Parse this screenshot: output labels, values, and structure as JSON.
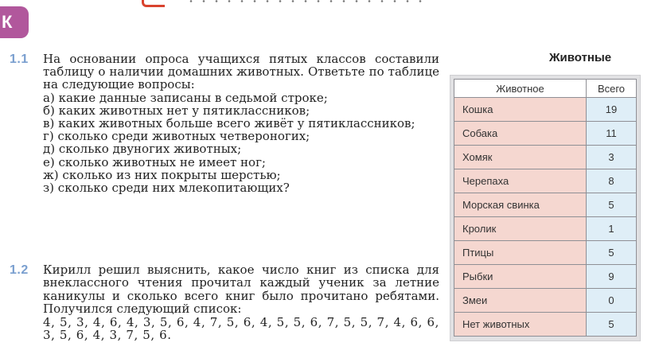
{
  "corner_tab": "К",
  "problem1": {
    "number": "1.1",
    "intro": "На основании опроса учащихся пятых классов составили таблицу о наличии домашних животных. Ответьте по таблице на следующие вопросы:",
    "questions": [
      "а) какие данные записаны в седьмой строке;",
      "б) каких животных нет у пятиклассников;",
      "в) каких животных больше всего живёт у пятиклассников;",
      "г) сколько среди животных четвероногих;",
      "д) сколько двуногих животных;",
      "е) сколько животных не имеет ног;",
      "ж) сколько из них покрыты шерстью;",
      "з) сколько среди них млекопитающих?"
    ]
  },
  "problem2": {
    "number": "1.2",
    "text": "Кирилл решил выяснить, какое число книг из списка для внеклассного чтения прочитал каждый ученик за летние каникулы и сколько всего книг было прочитано ребятами. Получился следующий список:",
    "sequence": "4, 5, 3, 4, 6, 4, 3, 5, 6, 4, 7, 5, 6, 4, 5, 5, 6, 7, 5, 5, 7, 4, 6, 6, 3, 5, 6, 4, 3, 7, 5, 6."
  },
  "table": {
    "title": "Животные",
    "headers": [
      "Животное",
      "Всего"
    ],
    "rows": [
      [
        "Кошка",
        "19"
      ],
      [
        "Собака",
        "11"
      ],
      [
        "Хомяк",
        "3"
      ],
      [
        "Черепаха",
        "8"
      ],
      [
        "Морская свинка",
        "5"
      ],
      [
        "Кролик",
        "1"
      ],
      [
        "Птицы",
        "5"
      ],
      [
        "Рыбки",
        "9"
      ],
      [
        "Змеи",
        "0"
      ],
      [
        "Нет животных",
        "5"
      ]
    ]
  }
}
